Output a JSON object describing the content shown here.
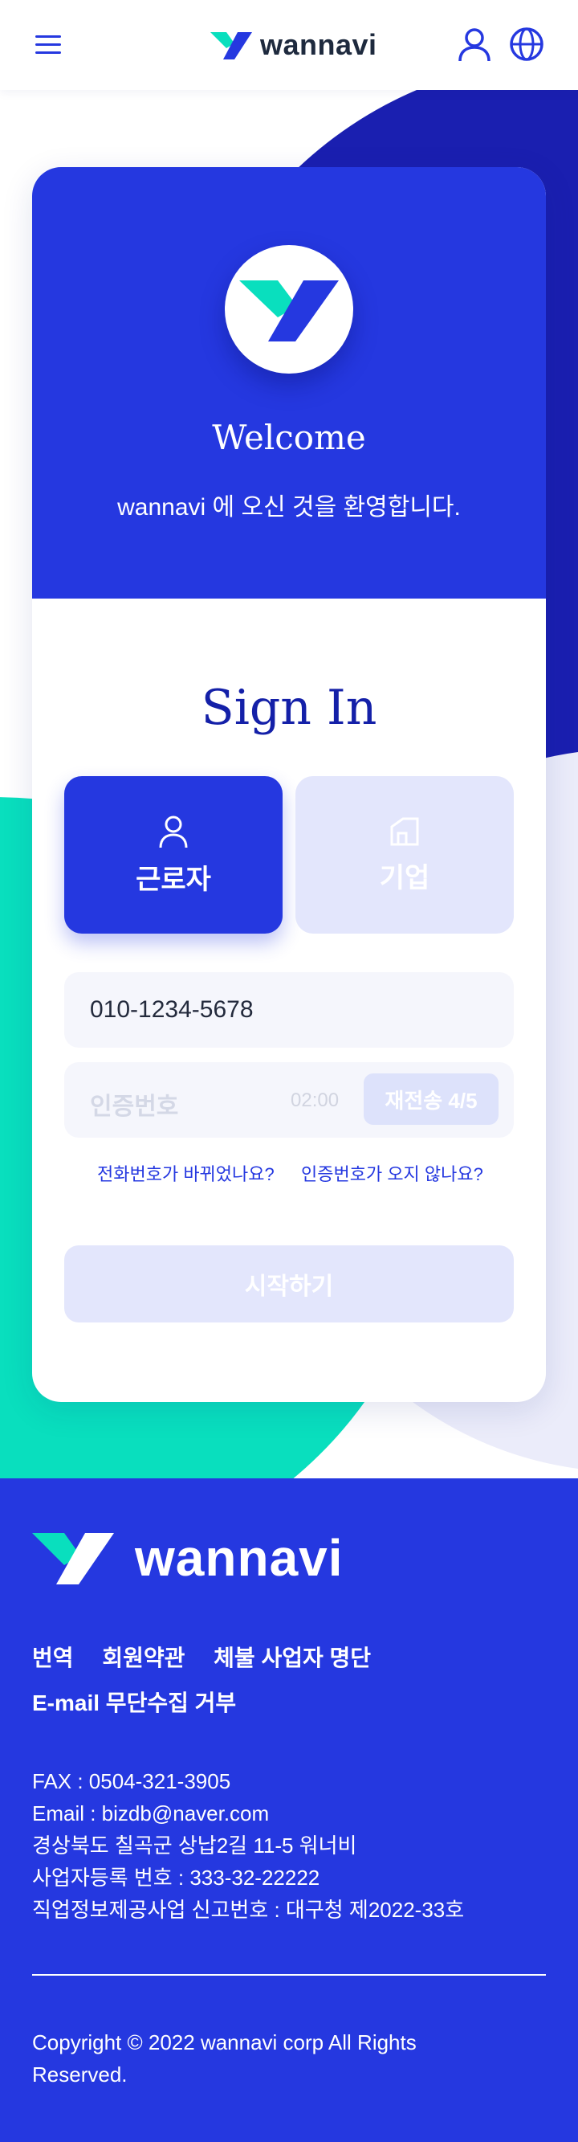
{
  "header": {
    "brand": "wannavi",
    "menu_icon": "hamburger-menu-icon",
    "user_icon": "user-icon",
    "language_icon": "globe-icon"
  },
  "colors": {
    "primary": "#2538e0",
    "navy": "#1a1fb0",
    "mint": "#09dfbe",
    "lavender": "#e3e6fc"
  },
  "welcome": {
    "title": "Welcome",
    "subtitle": "wannavi 에 오신 것을 환영합니다."
  },
  "signin": {
    "title": "Sign In",
    "types": [
      {
        "label": "근로자",
        "icon": "person-icon",
        "selected": true
      },
      {
        "label": "기업",
        "icon": "building-icon",
        "selected": false
      }
    ],
    "phone_value": "010-1234-5678",
    "code_placeholder": "인증번호",
    "timer": "02:00",
    "resend_label": "재전송 4/5",
    "phone_changed_link": "전화번호가 바뀌었나요?",
    "no_code_link": "인증번호가 오지 않나요?",
    "start_label": "시작하기"
  },
  "footer": {
    "brand": "wannavi",
    "links": [
      "번역",
      "회원약관",
      "체불 사업자 명단",
      "E-mail 무단수집 거부"
    ],
    "info": [
      "FAX : 0504-321-3905",
      "Email : bizdb@naver.com",
      "경상북도 칠곡군 상납2길 11-5 워너비",
      "사업자등록 번호 : 333-32-22222",
      "직업정보제공사업 신고번호 : 대구청 제2022-33호"
    ],
    "copyright": "Copyright © 2022 wannavi corp All Rights Reserved."
  }
}
